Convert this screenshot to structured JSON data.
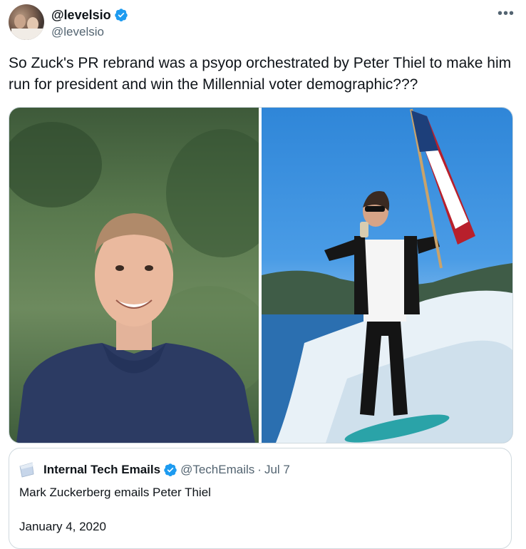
{
  "tweet": {
    "display_name": "@levelsio",
    "handle": "@levelsio",
    "more_icon": "•••",
    "text": "So Zuck's PR rebrand was a psyop orchestrated by Peter Thiel to make him run for president and win the Millennial voter demographic???"
  },
  "media": {
    "left_photo": "portrait photo",
    "right_photo": "surfing photo"
  },
  "quote": {
    "display_name": "Internal Tech Emails",
    "handle": "@TechEmails",
    "separator": "·",
    "date": "Jul 7",
    "text": "Mark Zuckerberg emails Peter Thiel",
    "text2": "January 4, 2020"
  },
  "colors": {
    "verified": "#1d9bf0",
    "secondary_text": "#536471",
    "border": "#cfd9de"
  }
}
